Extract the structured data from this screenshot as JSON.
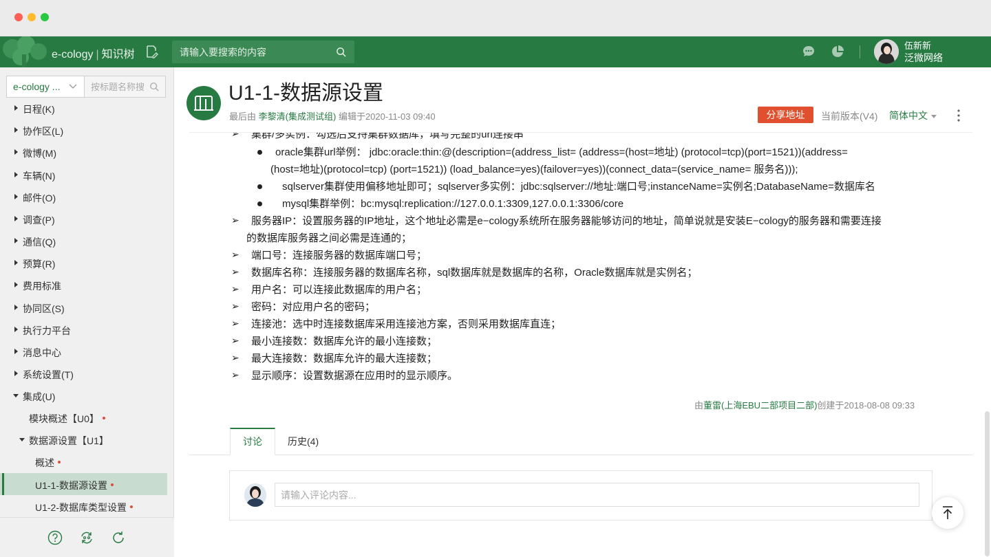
{
  "colors": {
    "brand_green": "#267a42",
    "share_red": "#e0502e",
    "required_dot": "#e24b3b",
    "active_bg": "#c8dccf"
  },
  "app": {
    "name": "e-cology",
    "section": "知识树",
    "search_placeholder": "请输入要搜索的内容",
    "user": {
      "name": "伍新新",
      "org": "泛微网络"
    }
  },
  "sidebar": {
    "select_value": "e-cology ...",
    "search_placeholder": "按标题名称搜",
    "items": [
      {
        "label": "日程(K)",
        "icon": "caret-right-icon"
      },
      {
        "label": "协作区(L)",
        "icon": "caret-right-icon"
      },
      {
        "label": "微博(M)",
        "icon": "caret-right-icon"
      },
      {
        "label": "车辆(N)",
        "icon": "caret-right-icon"
      },
      {
        "label": "邮件(O)",
        "icon": "caret-right-icon"
      },
      {
        "label": "调查(P)",
        "icon": "caret-right-icon"
      },
      {
        "label": "通信(Q)",
        "icon": "caret-right-icon"
      },
      {
        "label": "预算(R)",
        "icon": "caret-right-icon"
      },
      {
        "label": "费用标准",
        "icon": "caret-right-icon"
      },
      {
        "label": "协同区(S)",
        "icon": "caret-right-icon"
      },
      {
        "label": "执行力平台",
        "icon": "caret-right-icon"
      },
      {
        "label": "消息中心",
        "icon": "caret-right-icon"
      },
      {
        "label": "系统设置(T)",
        "icon": "caret-right-icon"
      },
      {
        "label": "集成(U)",
        "icon": "caret-down-icon"
      },
      {
        "label": "模块概述【U0】",
        "icon": "none",
        "dot": true
      },
      {
        "label": "数据源设置【U1】",
        "icon": "caret-down-icon"
      },
      {
        "label": "概述",
        "icon": "none",
        "dot": true
      },
      {
        "label": "U1-1-数据源设置",
        "icon": "none",
        "dot": true,
        "active": true
      },
      {
        "label": "U1-2-数据库类型设置",
        "icon": "none",
        "dot": true
      }
    ],
    "footer_icons": [
      "help-icon",
      "sync-icon",
      "refresh-icon"
    ]
  },
  "page": {
    "title": "U1-1-数据源设置",
    "meta_prefix": "最后由",
    "editor": "李黎清(集成测试组)",
    "meta_suffix": "编辑于2020-11-03 09:40",
    "share_label": "分享地址",
    "version": "当前版本(V4)",
    "language": "简体中文"
  },
  "content": {
    "lines": [
      "集群/多实例：勾选后支持集群数据库，填写完整的url连接串",
      "oracle集群url举例：  jdbc:oracle:thin:@(description=(address_list= (address=(host=地址) (protocol=tcp)(port=1521))(address=",
      "(host=地址)(protocol=tcp) (port=1521)) (load_balance=yes)(failover=yes))(connect_data=(service_name= 服务名)));",
      "sqlserver集群使用偏移地址即可；sqlserver多实例：jdbc:sqlserver://地址:端口号;instanceName=实例名;DatabaseName=数据库名",
      "mysql集群举例：bc:mysql:replication://127.0.0.1:3309,127.0.0.1:3306/core",
      "服务器IP：设置服务器的IP地址，这个地址必需是e−cology系统所在服务器能够访问的地址，简单说就是安装E−cology的服务器和需要连接",
      "的数据库服务器之间必需是连通的；",
      "端口号：连接服务器的数据库端口号；",
      "数据库名称：连接服务器的数据库名称，sql数据库就是数据库的名称，Oracle数据库就是实例名；",
      "用户名：可以连接此数据库的用户名；",
      "密码：对应用户名的密码；",
      "连接池：选中时连接数据库采用连接池方案，否则采用数据库直连；",
      "最小连接数：数据库允许的最小连接数；",
      "最大连接数：数据库允许的最大连接数；",
      "显示顺序：设置数据源在应用时的显示顺序。"
    ],
    "arrow_glyph": "➢"
  },
  "footer": {
    "created_prefix": "由",
    "created_author": "董雷(上海EBU二部项目二部)",
    "created_suffix": "创建于2018-08-08 09:33"
  },
  "tabs": {
    "discuss": "讨论",
    "history": "历史(4)"
  },
  "comment": {
    "placeholder": "请输入评论内容..."
  }
}
